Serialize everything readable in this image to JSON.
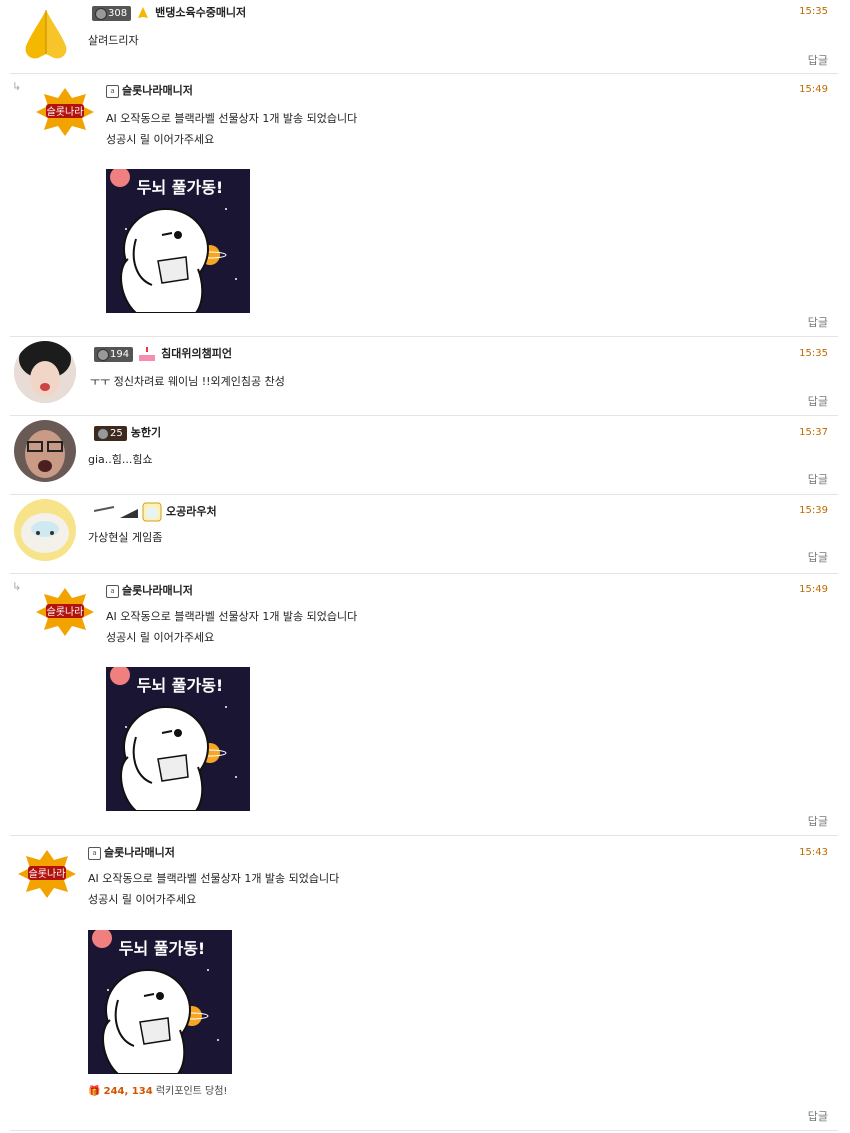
{
  "reply_label": "답글",
  "sticker_text": "두뇌 풀가동!",
  "comments": [
    {
      "nick": "밴댕소육수중매니저",
      "level": "308",
      "time": "15:35",
      "lines": [
        "살려드리자"
      ]
    },
    {
      "nick": "슬롯나라매니저",
      "time": "15:49",
      "lines": [
        "AI 오작동으로 블랙라벨 선물상자 1개 발송 되었습니다",
        "성공시 릴 이어가주세요"
      ]
    },
    {
      "nick": "침대위의챔피언",
      "level": "194",
      "time": "15:35",
      "lines": [
        "ㅜㅜ 정신차려료 웨이님 !!외계인침공   찬성"
      ]
    },
    {
      "nick": "농한기",
      "level": "25",
      "time": "15:37",
      "lines": [
        "gia..힘...힘쇼"
      ]
    },
    {
      "nick": "오공라우처",
      "time": "15:39",
      "lines": [
        "가상현실 게임좀"
      ]
    },
    {
      "nick": "슬롯나라매니저",
      "time": "15:49",
      "lines": [
        "AI 오작동으로 블랙라벨 선물상자 1개 발송 되었습니다",
        "성공시 릴 이어가주세요"
      ]
    },
    {
      "nick": "슬롯나라매니저",
      "time": "15:43",
      "lines": [
        "AI 오작동으로 블랙라벨 선물상자 1개 발송 되었습니다",
        "성공시 릴 이어가주세요"
      ],
      "points_value": "244, 134",
      "points_label": " 럭키포인트 당첨!"
    }
  ],
  "colors": {
    "time": "#c06a00",
    "points": "#d35400",
    "sticker_bg": "#1a1533"
  }
}
